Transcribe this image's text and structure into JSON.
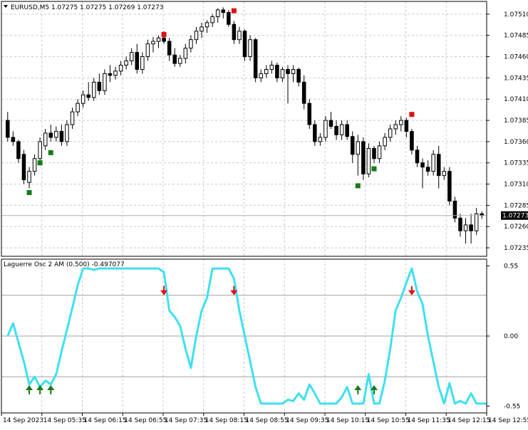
{
  "main_header": "EURUSD,M5  1.07275 1.07275 1.07269 1.07273",
  "osc_header": "Laguerre Osc 2 AM (0.500) -0.497077",
  "chart_data": [
    {
      "type": "candlestick",
      "symbol": "EURUSD",
      "timeframe": "M5",
      "ylim": [
        1.07225,
        1.07525
      ],
      "y_ticks": [
        "1.07510",
        "1.07485",
        "1.07460",
        "1.07435",
        "1.07410",
        "1.07385",
        "1.07360",
        "1.07335",
        "1.07310",
        "1.07285",
        "1.07260",
        "1.07235"
      ],
      "current_price": "1.07273",
      "colors": {
        "bull": "#ffffff",
        "bear": "#000000",
        "grid": "#c8c8c8",
        "buy_marker": "#1a7a1a",
        "sell_marker": "#e01010"
      },
      "candles": [
        [
          1.07385,
          1.07395,
          1.0736,
          1.07365
        ],
        [
          1.07365,
          1.07372,
          1.07355,
          1.0736
        ],
        [
          1.0736,
          1.07362,
          1.07335,
          1.0734
        ],
        [
          1.07345,
          1.0735,
          1.0731,
          1.07315
        ],
        [
          1.07312,
          1.0733,
          1.07305,
          1.07325
        ],
        [
          1.07325,
          1.07345,
          1.0732,
          1.0734
        ],
        [
          1.0734,
          1.07365,
          1.07335,
          1.0736
        ],
        [
          1.07355,
          1.07375,
          1.0735,
          1.0737
        ],
        [
          1.0737,
          1.0738,
          1.0736,
          1.07365
        ],
        [
          1.07365,
          1.07378,
          1.0736,
          1.07372
        ],
        [
          1.07372,
          1.0738,
          1.07355,
          1.0736
        ],
        [
          1.0736,
          1.07385,
          1.07355,
          1.0738
        ],
        [
          1.0738,
          1.074,
          1.07375,
          1.07395
        ],
        [
          1.07395,
          1.0741,
          1.0739,
          1.07405
        ],
        [
          1.07405,
          1.0742,
          1.074,
          1.07415
        ],
        [
          1.07415,
          1.0743,
          1.07408,
          1.07412
        ],
        [
          1.07412,
          1.07435,
          1.07408,
          1.0743
        ],
        [
          1.0743,
          1.0744,
          1.07415,
          1.0742
        ],
        [
          1.0742,
          1.07445,
          1.07415,
          1.0744
        ],
        [
          1.0744,
          1.0745,
          1.0743,
          1.07438
        ],
        [
          1.07438,
          1.07448,
          1.07433,
          1.07443
        ],
        [
          1.07443,
          1.07455,
          1.07438,
          1.0745
        ],
        [
          1.0745,
          1.0746,
          1.07445,
          1.07455
        ],
        [
          1.07455,
          1.0747,
          1.0745,
          1.07465
        ],
        [
          1.07465,
          1.07475,
          1.0744,
          1.07445
        ],
        [
          1.07445,
          1.07465,
          1.0744,
          1.0746
        ],
        [
          1.0746,
          1.0748,
          1.07455,
          1.07475
        ],
        [
          1.07475,
          1.07483,
          1.07465,
          1.07478
        ],
        [
          1.07478,
          1.07485,
          1.0747,
          1.07482
        ],
        [
          1.07482,
          1.0749,
          1.07475,
          1.07478
        ],
        [
          1.07478,
          1.07482,
          1.07455,
          1.07462
        ],
        [
          1.07462,
          1.0747,
          1.07448,
          1.07452
        ],
        [
          1.07452,
          1.07462,
          1.07448,
          1.07458
        ],
        [
          1.07458,
          1.07475,
          1.07452,
          1.0747
        ],
        [
          1.0747,
          1.07485,
          1.07465,
          1.0748
        ],
        [
          1.0748,
          1.07495,
          1.07475,
          1.0749
        ],
        [
          1.0749,
          1.075,
          1.07482,
          1.07495
        ],
        [
          1.07495,
          1.07503,
          1.07488,
          1.075
        ],
        [
          1.075,
          1.0751,
          1.07495,
          1.07507
        ],
        [
          1.07507,
          1.07517,
          1.075,
          1.07515
        ],
        [
          1.07515,
          1.07518,
          1.07505,
          1.07512
        ],
        [
          1.07512,
          1.07515,
          1.07495,
          1.07498
        ],
        [
          1.07498,
          1.07502,
          1.07475,
          1.0748
        ],
        [
          1.0748,
          1.07495,
          1.07475,
          1.0749
        ],
        [
          1.0749,
          1.07492,
          1.07455,
          1.0746
        ],
        [
          1.0746,
          1.07485,
          1.07455,
          1.0748
        ],
        [
          1.0748,
          1.07482,
          1.0743,
          1.07435
        ],
        [
          1.07435,
          1.07445,
          1.0743,
          1.0744
        ],
        [
          1.0744,
          1.0745,
          1.07435,
          1.07445
        ],
        [
          1.07445,
          1.07455,
          1.0744,
          1.0745
        ],
        [
          1.0745,
          1.07453,
          1.0743,
          1.07435
        ],
        [
          1.07435,
          1.07448,
          1.0743,
          1.07445
        ],
        [
          1.07445,
          1.0745,
          1.07405,
          1.0744
        ],
        [
          1.0744,
          1.0745,
          1.0743,
          1.07445
        ],
        [
          1.07445,
          1.07447,
          1.07425,
          1.0743
        ],
        [
          1.0743,
          1.07438,
          1.07398,
          1.07405
        ],
        [
          1.07405,
          1.0741,
          1.07375,
          1.0738
        ],
        [
          1.0738,
          1.07385,
          1.07355,
          1.0736
        ],
        [
          1.0736,
          1.0737,
          1.07355,
          1.07365
        ],
        [
          1.07365,
          1.0739,
          1.0736,
          1.07385
        ],
        [
          1.07385,
          1.07395,
          1.07375,
          1.07378
        ],
        [
          1.07378,
          1.07385,
          1.07362,
          1.07368
        ],
        [
          1.07368,
          1.07385,
          1.07362,
          1.0738
        ],
        [
          1.0738,
          1.07385,
          1.07362,
          1.07366
        ],
        [
          1.07366,
          1.07372,
          1.07335,
          1.07345
        ],
        [
          1.07345,
          1.07368,
          1.0732,
          1.0736
        ],
        [
          1.0736,
          1.07365,
          1.07315,
          1.07322
        ],
        [
          1.07322,
          1.07358,
          1.07318,
          1.07352
        ],
        [
          1.07352,
          1.07355,
          1.07335,
          1.0734
        ],
        [
          1.0734,
          1.0736,
          1.07335,
          1.07355
        ],
        [
          1.07355,
          1.0737,
          1.0735,
          1.07365
        ],
        [
          1.07365,
          1.0738,
          1.0736,
          1.07375
        ],
        [
          1.07375,
          1.07385,
          1.07368,
          1.0738
        ],
        [
          1.0738,
          1.0739,
          1.07372,
          1.07385
        ],
        [
          1.07385,
          1.07388,
          1.07365,
          1.07372
        ],
        [
          1.07372,
          1.07375,
          1.07345,
          1.0735
        ],
        [
          1.0735,
          1.07355,
          1.0733,
          1.07335
        ],
        [
          1.07335,
          1.0734,
          1.07305,
          1.0733
        ],
        [
          1.0733,
          1.07338,
          1.0732,
          1.07325
        ],
        [
          1.07325,
          1.0735,
          1.0732,
          1.07345
        ],
        [
          1.07345,
          1.07355,
          1.07305,
          1.0732
        ],
        [
          1.0732,
          1.0733,
          1.07315,
          1.07325
        ],
        [
          1.07325,
          1.0733,
          1.07285,
          1.0729
        ],
        [
          1.0729,
          1.07295,
          1.07265,
          1.0727
        ],
        [
          1.0727,
          1.07275,
          1.07248,
          1.07255
        ],
        [
          1.07255,
          1.0727,
          1.0724,
          1.07262
        ],
        [
          1.07262,
          1.07275,
          1.0724,
          1.07255
        ],
        [
          1.07255,
          1.07282,
          1.0725,
          1.07275
        ],
        [
          1.07275,
          1.07278,
          1.07269,
          1.07273
        ]
      ],
      "buy_signals": [
        {
          "bar": 4,
          "price": 1.073
        },
        {
          "bar": 6,
          "price": 1.07335
        },
        {
          "bar": 8,
          "price": 1.07347
        },
        {
          "bar": 65,
          "price": 1.07308
        },
        {
          "bar": 68,
          "price": 1.07328
        }
      ],
      "sell_signals": [
        {
          "bar": 29,
          "price": 1.07486
        },
        {
          "bar": 42,
          "price": 1.07514
        },
        {
          "bar": 75,
          "price": 1.07392
        }
      ]
    },
    {
      "type": "line",
      "name": "Laguerre Osc 2 AM (0.500)",
      "value": -0.497077,
      "ylim": [
        -0.57,
        0.57
      ],
      "y_ticks": [
        "0.55",
        "0.00",
        "-0.55"
      ],
      "levels": [
        0.32,
        0.0,
        -0.32
      ],
      "colors": {
        "line": "#3ee0f0",
        "level": "#a0a0a0"
      },
      "x_labels": [
        "14 Sep 2023",
        "14 Sep 05:35",
        "14 Sep 06:15",
        "14 Sep 06:55",
        "14 Sep 07:35",
        "14 Sep 08:15",
        "14 Sep 08:55",
        "14 Sep 09:35",
        "14 Sep 10:15",
        "14 Sep 10:55",
        "14 Sep 11:35",
        "14 Sep 12:15",
        "14 Sep 12:55"
      ],
      "values": [
        0.0,
        0.1,
        -0.05,
        -0.2,
        -0.38,
        -0.32,
        -0.4,
        -0.35,
        -0.38,
        -0.3,
        -0.12,
        0.05,
        0.22,
        0.4,
        0.53,
        0.53,
        0.52,
        0.53,
        0.53,
        0.53,
        0.53,
        0.53,
        0.53,
        0.53,
        0.53,
        0.53,
        0.53,
        0.53,
        0.53,
        0.5,
        0.2,
        0.15,
        0.08,
        -0.1,
        -0.25,
        0.0,
        0.2,
        0.3,
        0.53,
        0.53,
        0.53,
        0.53,
        0.45,
        0.2,
        0.0,
        -0.2,
        -0.4,
        -0.53,
        -0.53,
        -0.53,
        -0.53,
        -0.53,
        -0.5,
        -0.51,
        -0.45,
        -0.5,
        -0.38,
        -0.45,
        -0.53,
        -0.53,
        -0.53,
        -0.53,
        -0.48,
        -0.4,
        -0.53,
        -0.53,
        -0.53,
        -0.3,
        -0.53,
        -0.53,
        -0.35,
        -0.1,
        0.2,
        0.3,
        0.42,
        0.53,
        0.35,
        0.25,
        0.0,
        -0.2,
        -0.4,
        -0.53,
        -0.37,
        -0.53,
        -0.51,
        -0.53,
        -0.45,
        -0.53,
        -0.53,
        -0.53
      ],
      "buy_signals": [
        4,
        6,
        8,
        65,
        68
      ],
      "sell_signals": [
        29,
        42,
        75
      ]
    }
  ]
}
